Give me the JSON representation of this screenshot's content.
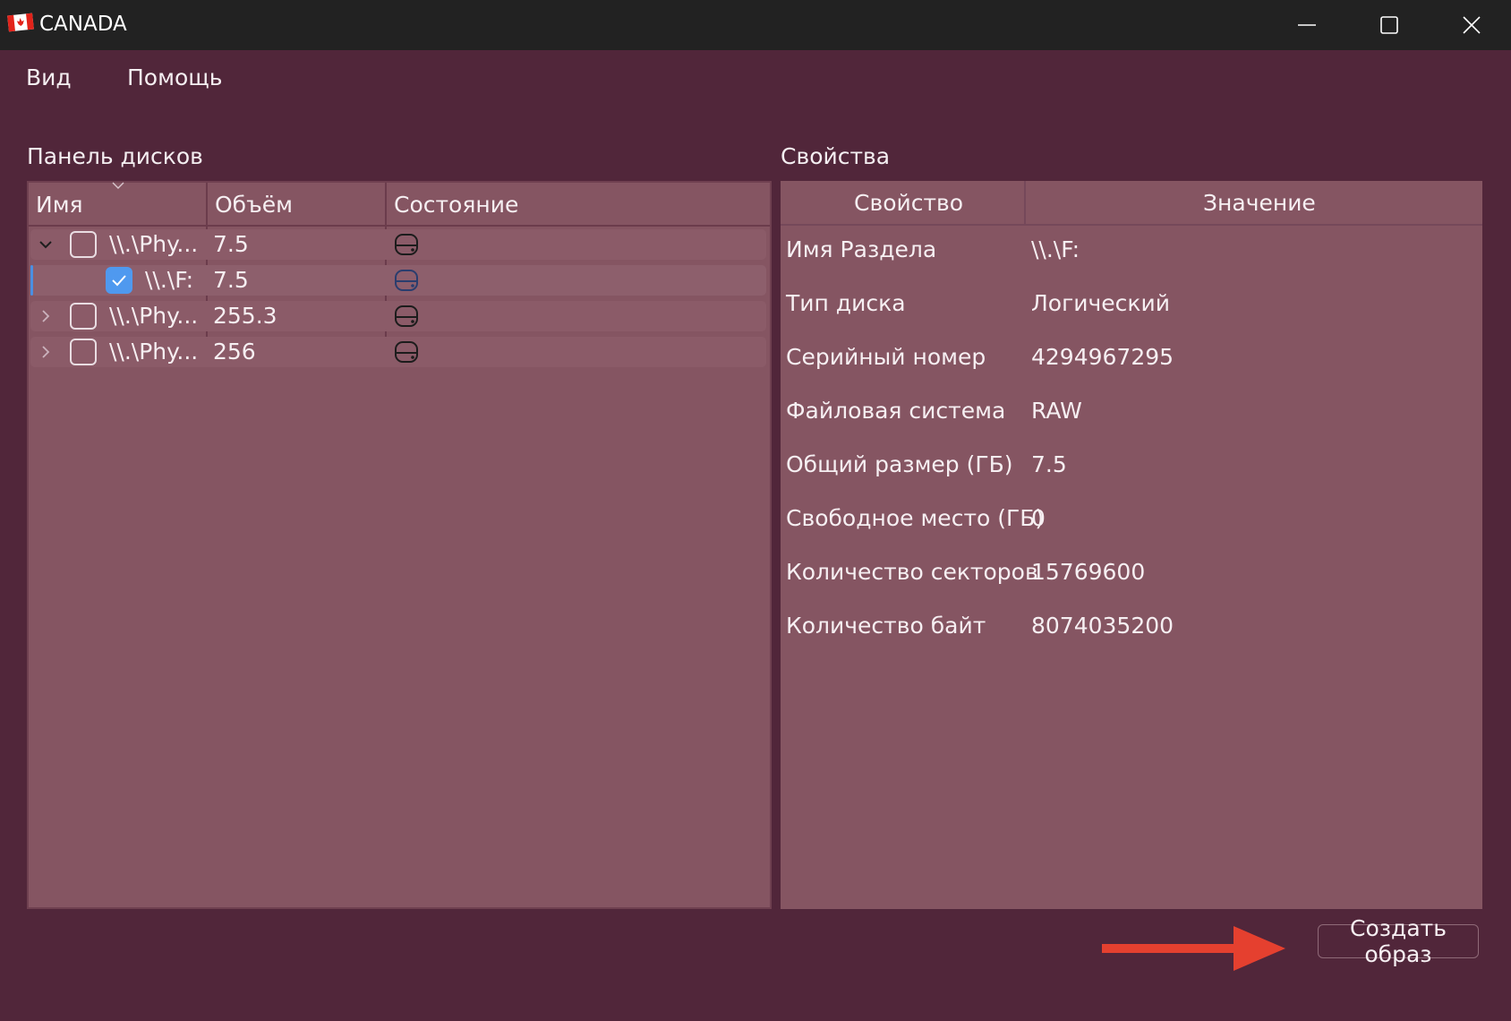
{
  "window": {
    "title": "CANADA"
  },
  "menu": {
    "items": [
      "Вид",
      "Помощь"
    ]
  },
  "disk_panel": {
    "title": "Панель дисков",
    "columns": [
      "Имя",
      "Объём",
      "Состояние"
    ],
    "rows": [
      {
        "name": "\\\\.\\Phy...",
        "size": "7.5",
        "expander": "expanded",
        "checked": false,
        "indent": 0
      },
      {
        "name": "\\\\.\\F:",
        "size": "7.5",
        "expander": "none",
        "checked": true,
        "indent": 1,
        "selected": true
      },
      {
        "name": "\\\\.\\Phy...",
        "size": "255.3",
        "expander": "collapsed",
        "checked": false,
        "indent": 0
      },
      {
        "name": "\\\\.\\Phy...",
        "size": "256",
        "expander": "collapsed",
        "checked": false,
        "indent": 0
      }
    ],
    "status_icon": "drive-icon"
  },
  "properties": {
    "title": "Свойства",
    "columns": [
      "Свойство",
      "Значение"
    ],
    "rows": [
      {
        "property": "Имя Раздела",
        "value": "\\\\.\\F:"
      },
      {
        "property": "Тип диска",
        "value": "Логический"
      },
      {
        "property": "Серийный номер",
        "value": "4294967295"
      },
      {
        "property": "Файловая система",
        "value": "RAW"
      },
      {
        "property": "Общий размер (ГБ)",
        "value": "7.5"
      },
      {
        "property": "Свободное место (ГБ)",
        "value": "0"
      },
      {
        "property": "Количество секторов",
        "value": "15769600"
      },
      {
        "property": "Количество байт",
        "value": "8074035200"
      }
    ]
  },
  "actions": {
    "create_image": "Создать образ"
  },
  "colors": {
    "window_bg": "#51263a",
    "panel_bg": "#855562",
    "titlebar_bg": "#222222",
    "checkbox_accent": "#4f99ef",
    "annotation_arrow": "#e5402f"
  }
}
